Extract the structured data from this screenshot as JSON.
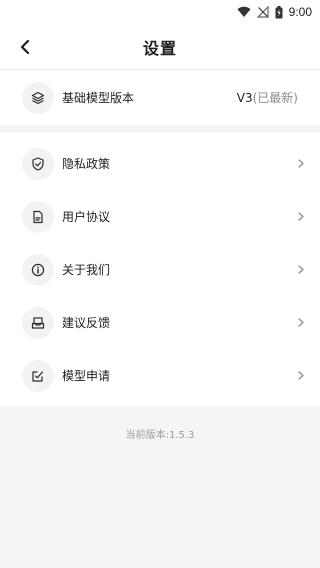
{
  "status_bar": {
    "time": "9:00",
    "icons": [
      "wifi-icon",
      "no-signal-icon",
      "battery-charging-icon"
    ]
  },
  "header": {
    "title": "设置",
    "back_icon": "back-arrow-icon"
  },
  "base_model": {
    "label": "基础模型版本",
    "value": "V3",
    "value_note": "(已最新)",
    "icon": "layers-icon"
  },
  "menu": {
    "items": [
      {
        "label": "隐私政策",
        "icon": "shield-check-icon"
      },
      {
        "label": "用户协议",
        "icon": "document-icon"
      },
      {
        "label": "关于我们",
        "icon": "info-icon"
      },
      {
        "label": "建议反馈",
        "icon": "inbox-icon"
      },
      {
        "label": "模型申请",
        "icon": "edit-check-icon"
      }
    ]
  },
  "footer": {
    "version_text": "当前版本:1.5.3"
  }
}
